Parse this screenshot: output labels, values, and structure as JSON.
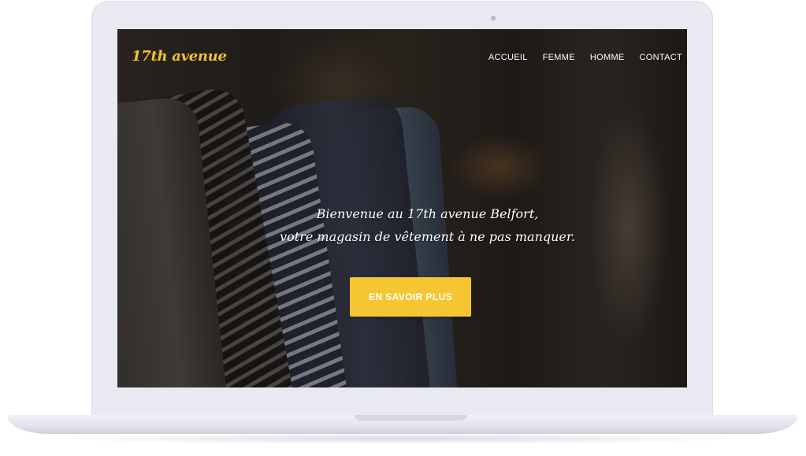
{
  "site": {
    "logo": "17th avenue",
    "accent_color": "#f6c632"
  },
  "nav": {
    "items": [
      {
        "label": "ACCUEIL"
      },
      {
        "label": "FEMME"
      },
      {
        "label": "HOMME"
      },
      {
        "label": "CONTACT"
      }
    ]
  },
  "hero": {
    "line1": "Bienvenue au 17th avenue Belfort,",
    "line2": "votre magasin de vêtement à ne pas manquer.",
    "cta_label": "EN SAVOIR PLUS"
  }
}
